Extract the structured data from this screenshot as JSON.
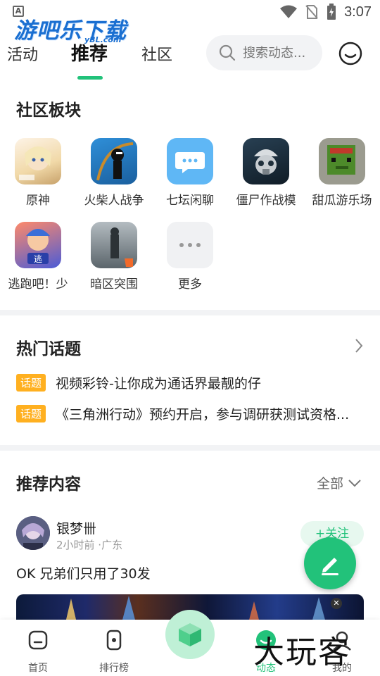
{
  "status_bar": {
    "time": "3:07",
    "indicator": "A"
  },
  "watermark_top": {
    "main": "游吧乐下载",
    "sub": "yBL.com"
  },
  "nav": {
    "tabs": [
      {
        "label": "活动"
      },
      {
        "label": "推荐"
      },
      {
        "label": "社区"
      }
    ],
    "active_tab": "推荐",
    "search_placeholder": "搜索动态..."
  },
  "boards": {
    "title": "社区板块",
    "items": [
      {
        "label": "原神"
      },
      {
        "label": "火柴人战争"
      },
      {
        "label": "七坛闲聊"
      },
      {
        "label": "僵尸作战模"
      },
      {
        "label": "甜瓜游乐场"
      },
      {
        "label": "逃跑吧！少"
      },
      {
        "label": "暗区突围"
      },
      {
        "label": "更多"
      }
    ]
  },
  "hot_topics": {
    "title": "热门话题",
    "items": [
      {
        "badge": "话题",
        "text": "视频彩铃-让你成为通话界最靓的仔"
      },
      {
        "badge": "话题",
        "text": "《三角洲行动》预约开启，参与调研获测试资格..."
      }
    ]
  },
  "recommended": {
    "title": "推荐内容",
    "filter": "全部",
    "post": {
      "user": "银梦卌",
      "meta": "2小时前 ·广东",
      "follow": "+关注",
      "text": "OK 兄弟们只用了30发"
    }
  },
  "bottom_nav": {
    "items": [
      {
        "label": "首页"
      },
      {
        "label": "排行榜"
      },
      {
        "label": "动态"
      },
      {
        "label": "我的"
      }
    ],
    "active": "动态"
  },
  "watermark_bottom": "大玩客",
  "colors": {
    "accent": "#22c27a",
    "badge": "#ffb020",
    "text": "#222222"
  }
}
